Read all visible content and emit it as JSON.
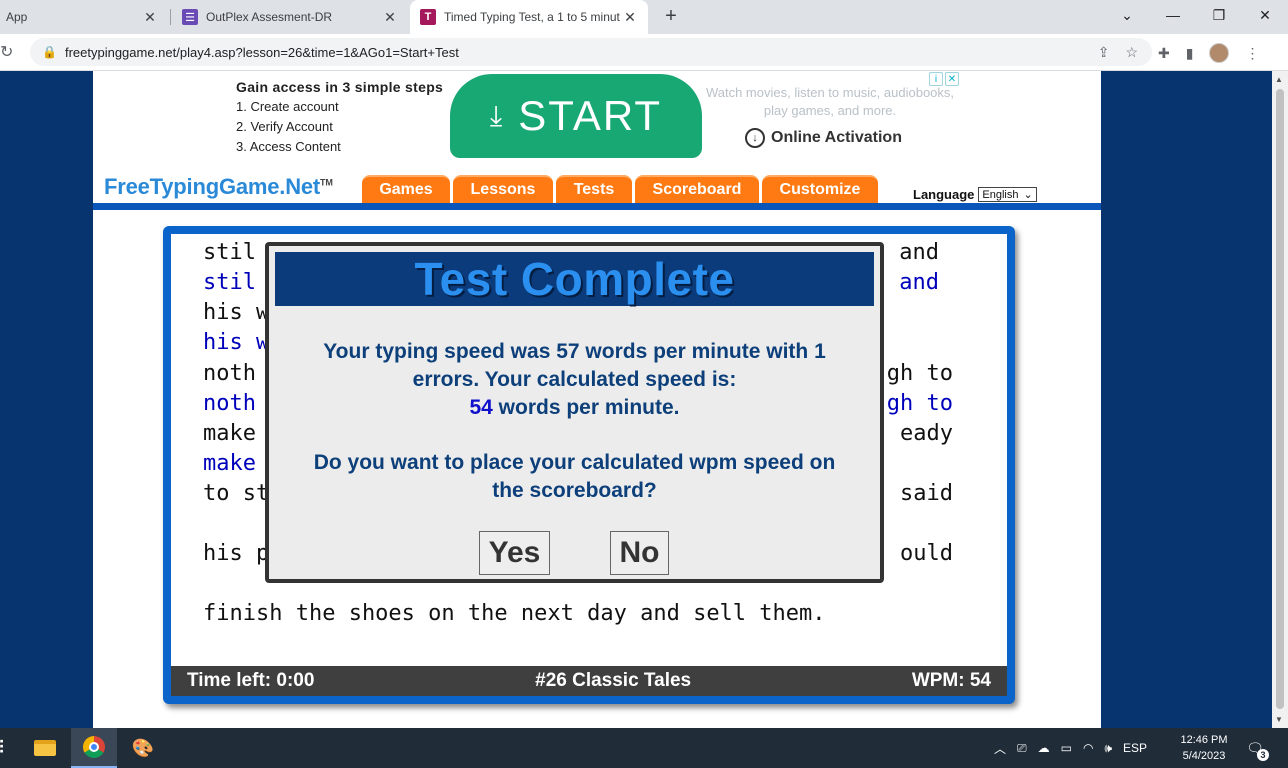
{
  "browser": {
    "tabs": [
      {
        "title": "App",
        "active": false
      },
      {
        "title": "OutPlex Assesment-DR",
        "active": false
      },
      {
        "title": "Timed Typing Test, a 1 to 5 minut",
        "active": true
      }
    ],
    "url": "freetypinggame.net/play4.asp?lesson=26&time=1&AGo1=Start+Test"
  },
  "ad": {
    "steps_heading": "Gain access in 3 simple steps",
    "steps": [
      "1. Create account",
      "2. Verify Account",
      "3. Access Content"
    ],
    "start_label": "START",
    "watch_text": "Watch movies, listen to music, audiobooks, play games, and more.",
    "online_label": "Online Activation"
  },
  "site": {
    "logo": "FreeTypingGame.Net",
    "logo_tm": "TM",
    "nav": [
      "Games",
      "Lessons",
      "Tests",
      "Scoreboard",
      "Customize"
    ],
    "language_label": "Language",
    "language_value": "English"
  },
  "typing": {
    "lines_left": [
      {
        "text": "stil",
        "typed": false
      },
      {
        "text": "stil",
        "typed": true
      },
      {
        "text": "his w",
        "typed": false
      },
      {
        "text": "his w",
        "typed": true
      },
      {
        "text": "noth",
        "typed": false
      },
      {
        "text": "noth",
        "typed": true
      },
      {
        "text": "make",
        "typed": false
      },
      {
        "text": "make",
        "typed": true
      },
      {
        "text": "to st",
        "typed": false
      },
      {
        "text": "his p",
        "typed": false
      }
    ],
    "lines_right": [
      {
        "text": "and",
        "typed": false
      },
      {
        "text": "and",
        "typed": true
      },
      {
        "text": "gh to",
        "typed": false
      },
      {
        "text": "gh to",
        "typed": true
      },
      {
        "text": "eady",
        "typed": false
      },
      {
        "text": "said",
        "typed": false
      },
      {
        "text": "ould",
        "typed": false
      }
    ],
    "last_line": "finish the shoes on the next day and sell them.",
    "time_left": "Time left: 0:00",
    "lesson_name": "#26 Classic Tales",
    "wpm": "WPM: 54"
  },
  "modal": {
    "title": "Test Complete",
    "msg_line1": "Your typing speed was 57 words per minute with 1",
    "msg_line2": "errors. Your calculated speed is:",
    "calc_speed": "54",
    "msg_line3": " words per minute.",
    "question_line1": "Do you want to place your calculated wpm speed on",
    "question_line2": "the scoreboard?",
    "yes_label": "Yes",
    "no_label": "No"
  },
  "taskbar": {
    "lang": "ESP",
    "time": "12:46 PM",
    "date": "5/4/2023",
    "notif_count": "3"
  }
}
